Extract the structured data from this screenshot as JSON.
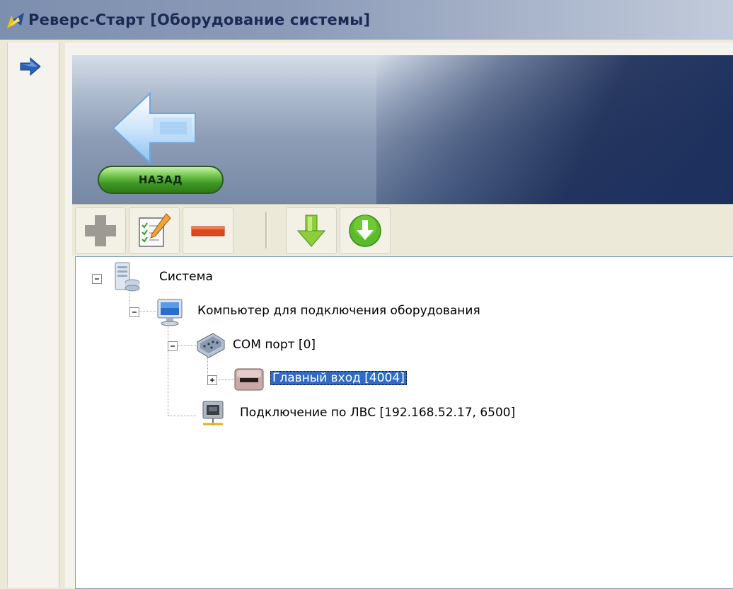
{
  "window": {
    "title": "Реверс-Старт [Оборудование системы]"
  },
  "banner": {
    "back_label": "НАЗАД"
  },
  "toolbar": {
    "buttons": [
      {
        "name": "add-icon"
      },
      {
        "name": "edit-icon"
      },
      {
        "name": "remove-icon"
      },
      {
        "name": "download-arrow-icon"
      },
      {
        "name": "download-circle-icon"
      }
    ]
  },
  "tree": {
    "system": "Система",
    "computer": "Компьютер для подключения оборудования",
    "com_port": "COM порт  [0]",
    "main_entry": "Главный вход  [4004]",
    "lan": "Подключение по ЛВС  [192.168.52.17, 6500]"
  },
  "colors": {
    "selection": "#316ac5",
    "back_button": "#4aa62d"
  }
}
